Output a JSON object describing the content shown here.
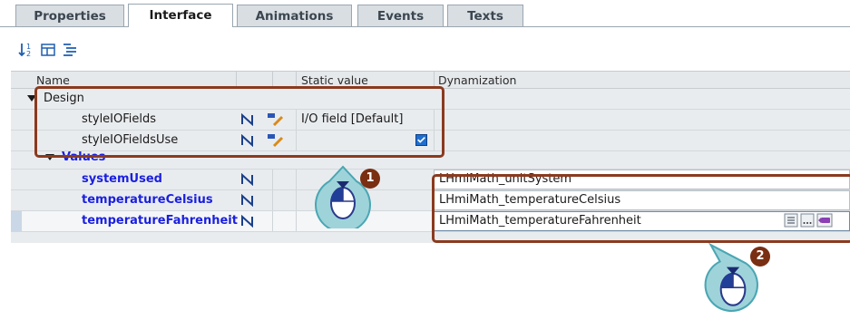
{
  "tabs": [
    {
      "label": "Properties"
    },
    {
      "label": "Interface"
    },
    {
      "label": "Animations"
    },
    {
      "label": "Events"
    },
    {
      "label": "Texts"
    }
  ],
  "toolbar": {
    "icons": [
      "sort-icon",
      "expand-icon",
      "collapse-icon"
    ]
  },
  "columns": {
    "name": "Name",
    "static_value": "Static value",
    "dynamization": "Dynamization"
  },
  "groups": {
    "design": "Design",
    "values": "Values"
  },
  "rows": [
    {
      "name": "styleIOFields",
      "static_value": "I/O field  [Default]",
      "dynamization": ""
    },
    {
      "name": "styleIOFieldsUse",
      "static_value": "",
      "dynamization": "",
      "checked": true
    },
    {
      "name": "systemUsed",
      "static_value": "",
      "dynamization": "LHmiMath_unitSystem"
    },
    {
      "name": "temperatureCelsius",
      "static_value": "",
      "dynamization": "LHmiMath_temperatureCelsius"
    },
    {
      "name": "temperatureFahrenheit",
      "static_value": "",
      "dynamization": "LHmiMath_temperatureFahrenheit"
    }
  ],
  "callouts": {
    "first": "1",
    "second": "2"
  },
  "colors": {
    "accent": "#8b3a1e",
    "link_blue": "#1a1fe0",
    "badge": "#7a2e12"
  }
}
